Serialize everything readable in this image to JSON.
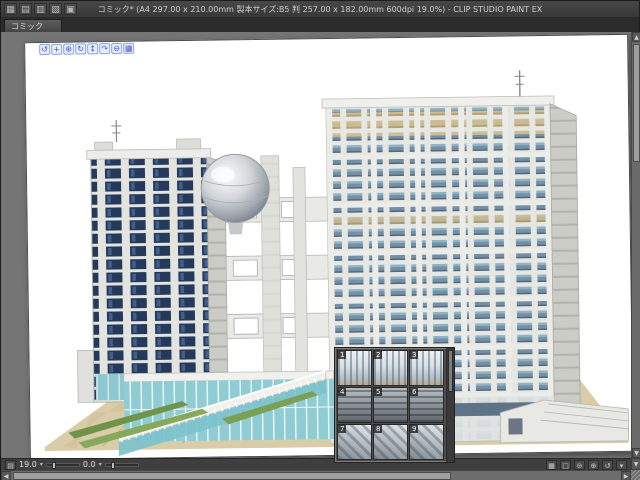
{
  "titlebar": {
    "title": "コミック* (A4 297.00 x 210.00mm 製本サイズ:B5 判 257.00 x 182.00mm 600dpi 19.0%) - CLIP STUDIO PAINT EX",
    "icons": [
      {
        "name": "system-menu-icon",
        "glyph": "▦"
      },
      {
        "name": "workspace-icon",
        "glyph": "▤"
      },
      {
        "name": "tile-windows-icon",
        "glyph": "▥"
      },
      {
        "name": "cascade-windows-icon",
        "glyph": "▧"
      },
      {
        "name": "full-view-icon",
        "glyph": "▣"
      }
    ]
  },
  "tabbar": {
    "tab_label": "コミック"
  },
  "launcher": {
    "icons": [
      {
        "name": "camera-rotate-icon",
        "glyph": "↺"
      },
      {
        "name": "camera-pan-icon",
        "glyph": "+"
      },
      {
        "name": "camera-zoom-icon",
        "glyph": "⊕"
      },
      {
        "name": "camera-roll-icon",
        "glyph": "↻"
      },
      {
        "name": "object-move-icon",
        "glyph": "↕"
      },
      {
        "name": "object-rotate-icon",
        "glyph": "↷"
      },
      {
        "name": "object-scale-icon",
        "glyph": "⊖"
      },
      {
        "name": "display-grid-icon",
        "glyph": "▦"
      }
    ]
  },
  "preset_panel": {
    "items": [
      {
        "number": "1"
      },
      {
        "number": "2"
      },
      {
        "number": "3"
      },
      {
        "number": "4"
      },
      {
        "number": "5"
      },
      {
        "number": "6"
      },
      {
        "number": "7"
      },
      {
        "number": "8"
      },
      {
        "number": "9"
      }
    ]
  },
  "statusbar": {
    "zoom_value": "19.0",
    "rotation_value": "0.0",
    "caret": "▾",
    "left_icons": [
      {
        "name": "panel-menu-icon",
        "glyph": "▤"
      }
    ],
    "right_icons": [
      {
        "name": "navigator-icon",
        "glyph": "▦"
      },
      {
        "name": "fit-screen-icon",
        "glyph": "□"
      },
      {
        "name": "zoom-out-icon",
        "glyph": "⊖"
      },
      {
        "name": "zoom-in-icon",
        "glyph": "⊕"
      },
      {
        "name": "rotate-reset-icon",
        "glyph": "↺"
      },
      {
        "name": "view-options-icon",
        "glyph": "▾"
      }
    ]
  },
  "scrollbars": {
    "up": "▲",
    "down": "▼",
    "left": "◀",
    "right": "▶"
  }
}
